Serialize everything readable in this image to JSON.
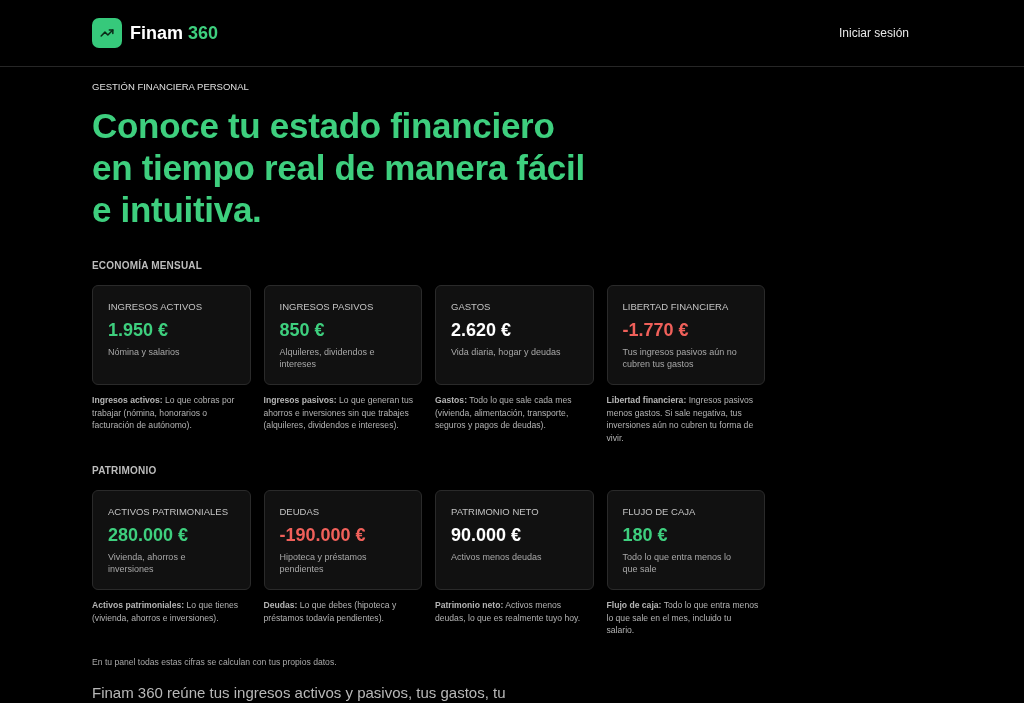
{
  "header": {
    "brand": {
      "name": "Finam",
      "suffix": "360"
    },
    "login": "Iniciar sesión"
  },
  "hero": {
    "eyebrow": "GESTIÓN FINANCIERA PERSONAL",
    "headline_lines": [
      "Conoce tu estado financiero",
      "en tiempo real de manera fácil",
      "e intuitiva."
    ]
  },
  "sections": [
    {
      "title": "ECONOMÍA MENSUAL",
      "cards": [
        {
          "label": "INGRESOS ACTIVOS",
          "value": "1.950 €",
          "color": "#3ecf7e",
          "caption": "Nómina y salarios",
          "description": "**Ingresos activos:** Lo que cobras por trabajar (nómina, honorarios o facturación de autónomo)."
        },
        {
          "label": "INGRESOS PASIVOS",
          "value": "850 €",
          "color": "#3ecf7e",
          "caption": "Alquileres, dividendos e intereses",
          "description": "**Ingresos pasivos:** Lo que generan tus ahorros e inversiones sin que trabajes (alquileres, dividendos e intereses)."
        },
        {
          "label": "GASTOS",
          "value": "2.620 €",
          "color": "#ffffff",
          "caption": "Vida diaria, hogar y deudas",
          "description": "**Gastos:** Todo lo que sale cada mes (vivienda, alimentación, transporte, seguros y pagos de deudas)."
        },
        {
          "label": "LIBERTAD FINANCIERA",
          "value": "-1.770 €",
          "color": "#f0605a",
          "caption": "Tus ingresos pasivos aún no cubren tus gastos",
          "description": "**Libertad financiera:** Ingresos pasivos menos gastos. Si sale negativa, tus inversiones aún no cubren tu forma de vivir."
        }
      ]
    },
    {
      "title": "PATRIMONIO",
      "cards": [
        {
          "label": "ACTIVOS PATRIMONIALES",
          "value": "280.000 €",
          "color": "#3ecf7e",
          "caption": "Vivienda, ahorros e inversiones",
          "description": "**Activos patrimoniales:** Lo que tienes (vivienda, ahorros e inversiones)."
        },
        {
          "label": "DEUDAS",
          "value": "-190.000 €",
          "color": "#f0605a",
          "caption": "Hipoteca y préstamos pendientes",
          "description": "**Deudas:** Lo que debes (hipoteca y préstamos todavía pendientes)."
        },
        {
          "label": "PATRIMONIO NETO",
          "value": "90.000 €",
          "color": "#ffffff",
          "caption": "Activos menos deudas",
          "description": "**Patrimonio neto:** Activos menos deudas, lo que es realmente tuyo hoy."
        },
        {
          "label": "FLUJO DE CAJA",
          "value": "180 €",
          "color": "#3ecf7e",
          "caption": "Todo lo que entra menos lo que sale",
          "description": "**Flujo de caja:** Todo lo que entra menos lo que sale en el mes, incluido tu salario."
        }
      ]
    }
  ],
  "footnote": "En tu panel todas estas cifras se calculan con tus propios datos.",
  "intro": "Finam 360 reúne tus ingresos activos y pasivos, tus gastos, tu"
}
